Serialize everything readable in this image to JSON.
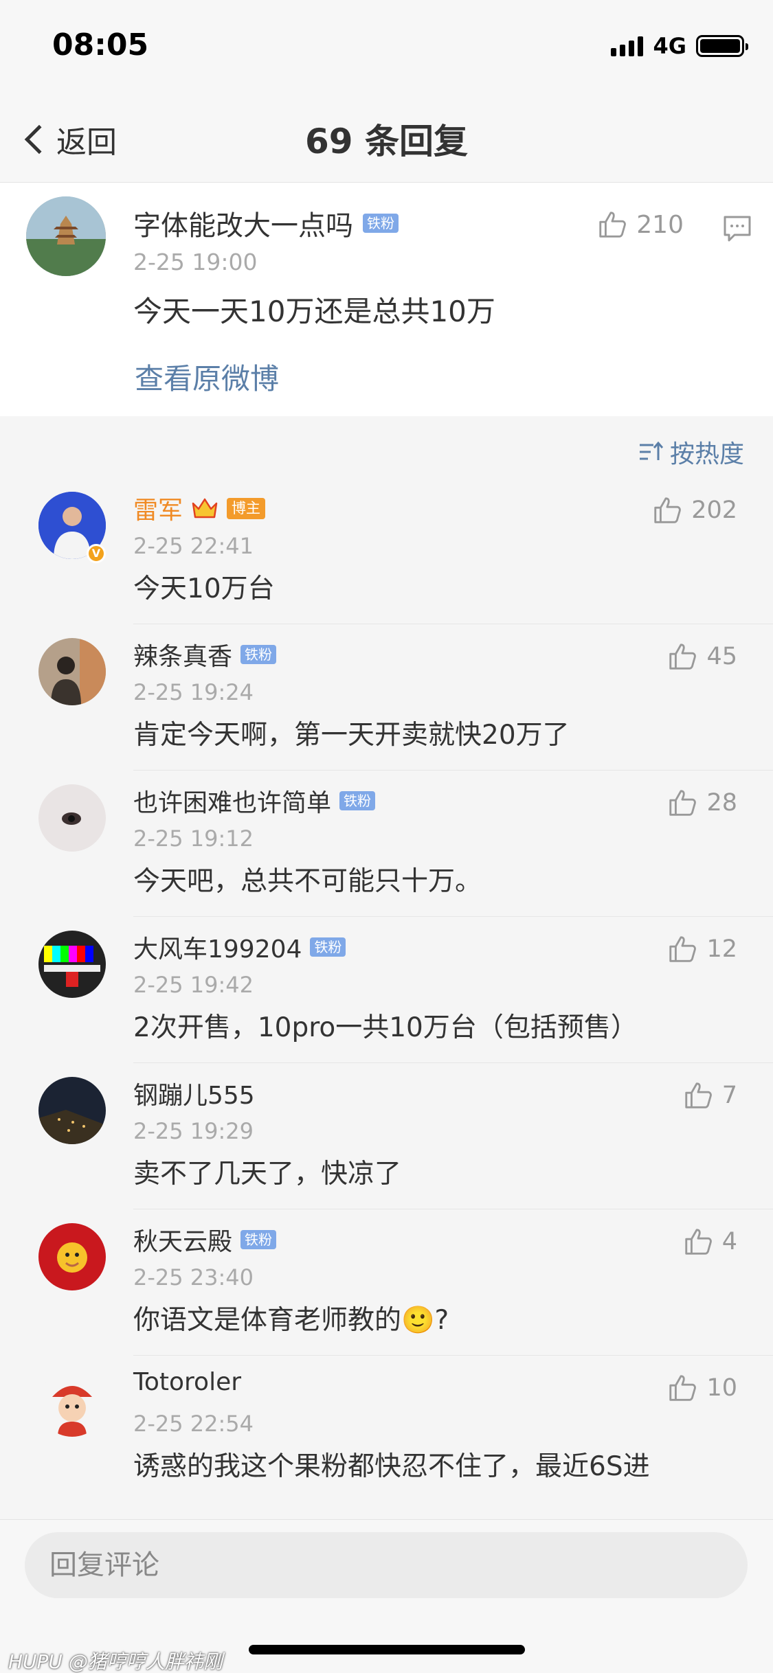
{
  "status_bar": {
    "time": "08:05",
    "network": "4G"
  },
  "nav": {
    "back_label": "返回",
    "title": "69 条回复"
  },
  "original": {
    "user": "字体能改大一点吗",
    "badge": "铁粉",
    "time": "2-25 19:00",
    "text": "今天一天10万还是总共10万",
    "likes": "210",
    "view_link": "查看原微博"
  },
  "sort": {
    "label": "按热度"
  },
  "replies": [
    {
      "user": "雷军",
      "badge": "博主",
      "time": "2-25 22:41",
      "text": "今天10万台",
      "likes": "202"
    },
    {
      "user": "辣条真香",
      "badge": "铁粉",
      "time": "2-25 19:24",
      "text": "肯定今天啊，第一天开卖就快20万了",
      "likes": "45"
    },
    {
      "user": "也许困难也许简单",
      "badge": "铁粉",
      "time": "2-25 19:12",
      "text": "今天吧，总共不可能只十万。",
      "likes": "28"
    },
    {
      "user": "大风车199204",
      "badge": "铁粉",
      "time": "2-25 19:42",
      "text": "2次开售，10pro一共10万台（包括预售）",
      "likes": "12"
    },
    {
      "user": "钢蹦儿555",
      "time": "2-25 19:29",
      "text": "卖不了几天了，快凉了",
      "likes": "7"
    },
    {
      "user": "秋天云殿",
      "badge": "铁粉",
      "time": "2-25 23:40",
      "text": "你语文是体育老师教的🙂?",
      "likes": "4"
    },
    {
      "user": "Totoroler",
      "time": "2-25 22:54",
      "text": "诱惑的我这个果粉都快忍不住了，最近6S进",
      "likes": "10"
    }
  ],
  "bottom": {
    "reply_placeholder": "回复评论",
    "watermark": "HUPU @猪哼哼人胖祎刚"
  }
}
